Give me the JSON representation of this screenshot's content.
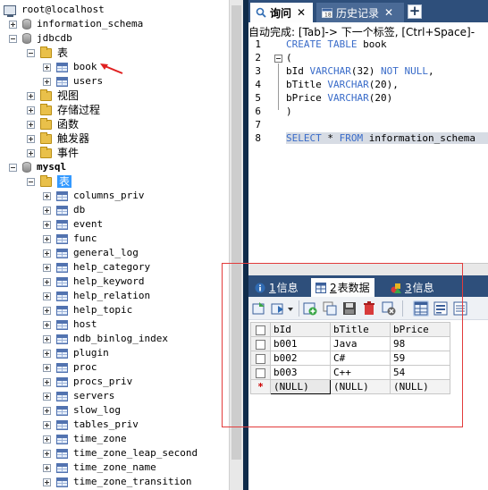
{
  "tree": {
    "host": "root@localhost",
    "items": [
      {
        "label": "information_schema"
      },
      {
        "label": "jdbcdb"
      },
      {
        "label": "表"
      },
      {
        "label": "book"
      },
      {
        "label": "users"
      },
      {
        "label": "视图"
      },
      {
        "label": "存储过程"
      },
      {
        "label": "函数"
      },
      {
        "label": "触发器"
      },
      {
        "label": "事件"
      },
      {
        "label": "mysql"
      },
      {
        "label": "表"
      }
    ],
    "mysql_tables": [
      "columns_priv",
      "db",
      "event",
      "func",
      "general_log",
      "help_category",
      "help_keyword",
      "help_relation",
      "help_topic",
      "host",
      "ndb_binlog_index",
      "plugin",
      "proc",
      "procs_priv",
      "servers",
      "slow_log",
      "tables_priv",
      "time_zone",
      "time_zone_leap_second",
      "time_zone_name",
      "time_zone_transition"
    ]
  },
  "tabs": {
    "query": "询问",
    "history": "历史记录",
    "close": "✕",
    "add": "+"
  },
  "autocomplete": "自动完成: [Tab]-> 下一个标签, [Ctrl+Space]-",
  "editor": {
    "line_numbers": [
      "1",
      "2",
      "3",
      "4",
      "5",
      "6",
      "7",
      "8"
    ],
    "l1a": "CREATE TABLE",
    "l1b": " book",
    "l2": "(",
    "l3a": "bId ",
    "l3b": "VARCHAR",
    "l3c": "(32) ",
    "l3d": "NOT NULL",
    "l3e": ",",
    "l4a": "bTitle ",
    "l4b": "VARCHAR",
    "l4c": "(20),",
    "l5a": "bPrice ",
    "l5b": "VARCHAR",
    "l5c": "(20)",
    "l6": ")",
    "l8a": "SELECT",
    "l8b": " * ",
    "l8c": "FROM",
    "l8d": " information_schema"
  },
  "result_tabs": {
    "info1_num": "1",
    "info1_label": "信息",
    "data_num": "2",
    "data_label": "表数据",
    "info3_num": "3",
    "info3_label": "信息"
  },
  "grid": {
    "columns": [
      "bId",
      "bTitle",
      "bPrice"
    ],
    "rows": [
      [
        "b001",
        "Java",
        "98"
      ],
      [
        "b002",
        "C#",
        "59"
      ],
      [
        "b003",
        "C++",
        "54"
      ]
    ],
    "new_row_marker": "*",
    "null_text": "(NULL)"
  }
}
